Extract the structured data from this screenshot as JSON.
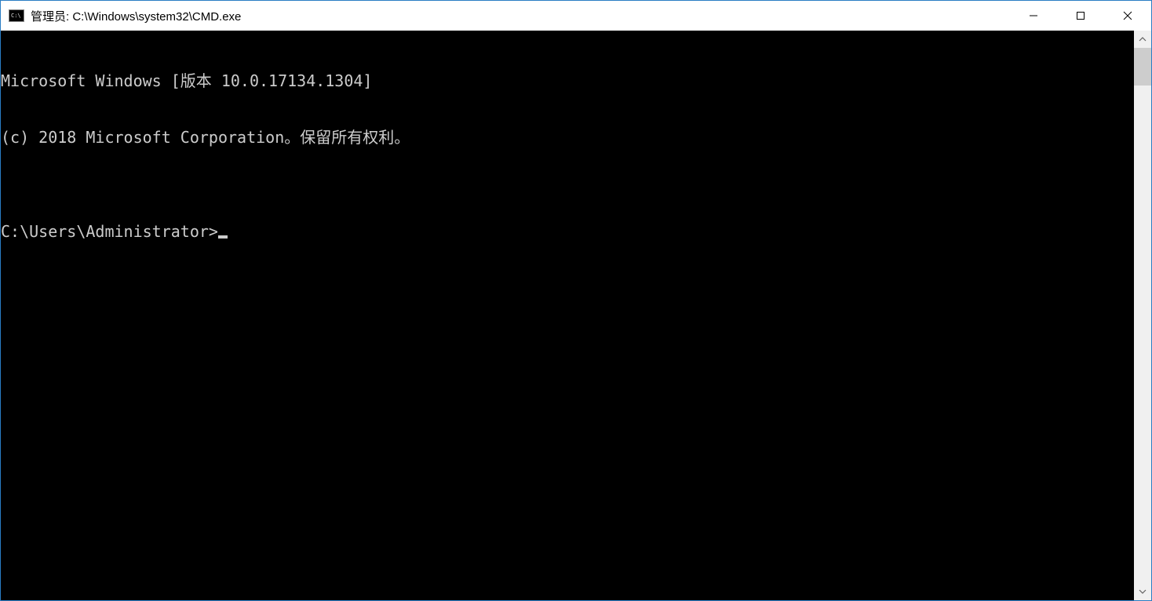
{
  "window": {
    "title": "管理员: C:\\Windows\\system32\\CMD.exe",
    "icon_label": "C:\\"
  },
  "terminal": {
    "line1": "Microsoft Windows [版本 10.0.17134.1304]",
    "line2": "(c) 2018 Microsoft Corporation。保留所有权利。",
    "blank": "",
    "prompt": "C:\\Users\\Administrator>"
  }
}
